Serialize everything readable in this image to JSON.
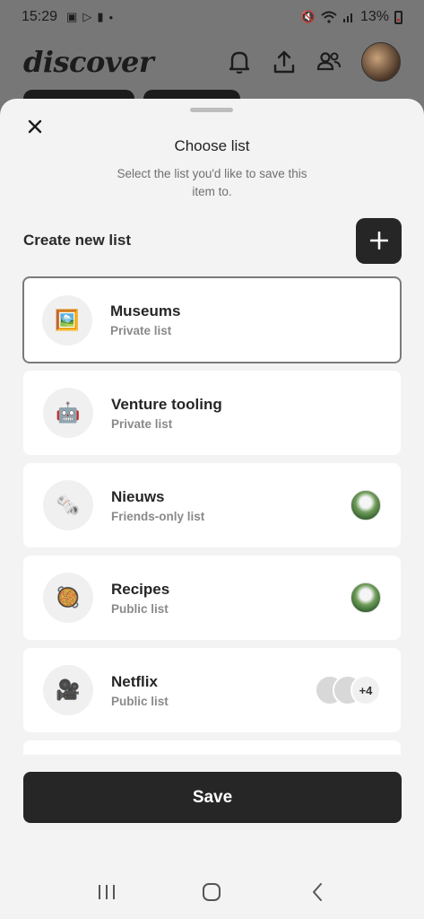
{
  "status_bar": {
    "time": "15:29",
    "battery_text": "13%"
  },
  "header": {
    "logo": "discover",
    "icons": [
      "bell-icon",
      "share-icon",
      "friends-icon",
      "avatar"
    ]
  },
  "sheet": {
    "title": "Choose list",
    "subtitle": "Select the list you'd like to save this item to.",
    "create_label": "Create new list",
    "create_button_symbol": "+",
    "save_label": "Save"
  },
  "lists": [
    {
      "emoji": "🖼️",
      "name": "Museums",
      "privacy": "Private list",
      "selected": true
    },
    {
      "emoji": "🤖",
      "name": "Venture tooling",
      "privacy": "Private list",
      "selected": false
    },
    {
      "emoji": "🗞️",
      "name": "Nieuws",
      "privacy": "Friends-only list",
      "selected": false
    },
    {
      "emoji": "🥘",
      "name": "Recipes",
      "privacy": "Public list",
      "selected": false
    },
    {
      "emoji": "🎥",
      "name": "Netflix",
      "privacy": "Public list",
      "selected": false,
      "more_members": "+4"
    }
  ],
  "colors": {
    "primary_dark": "#262626",
    "sheet_bg": "#f3f3f3",
    "card_bg": "#ffffff",
    "muted_text": "#8a8a8a"
  }
}
